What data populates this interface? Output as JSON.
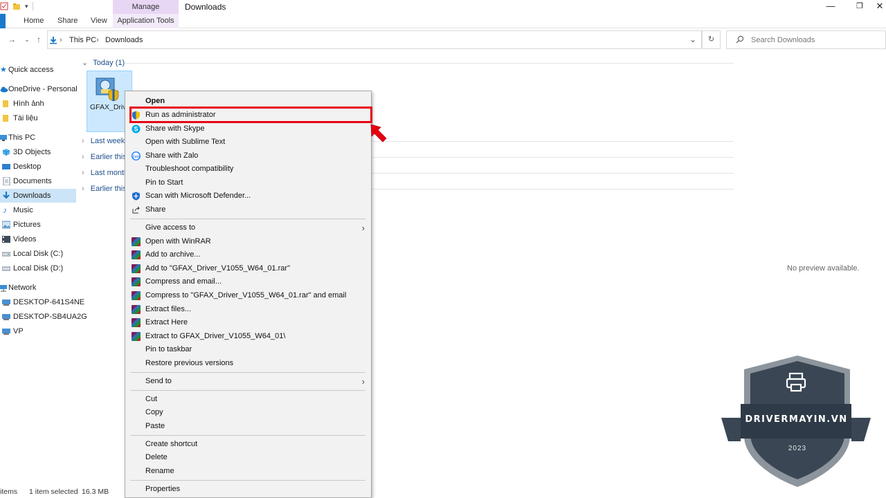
{
  "window": {
    "manage_tab": "Manage",
    "title": "Downloads",
    "minimize_glyph": "—",
    "maximize_glyph": "❐",
    "close_glyph": "✕"
  },
  "ribbon": {
    "tabs": [
      "Home",
      "Share",
      "View"
    ],
    "application_tools": "Application Tools"
  },
  "address": {
    "path": [
      "This PC",
      "Downloads"
    ],
    "search_placeholder": "Search Downloads"
  },
  "sidebar": {
    "items": [
      {
        "label": "Quick access",
        "icon": "star-icon"
      },
      {
        "label": "OneDrive - Personal",
        "icon": "cloud-icon"
      },
      {
        "label": "Hình ảnh",
        "icon": "folder-icon"
      },
      {
        "label": "Tài liệu",
        "icon": "folder-icon"
      },
      {
        "label": "This PC",
        "icon": "computer-icon"
      },
      {
        "label": "3D Objects",
        "icon": "cube-icon"
      },
      {
        "label": "Desktop",
        "icon": "desktop-icon"
      },
      {
        "label": "Documents",
        "icon": "documents-icon"
      },
      {
        "label": "Downloads",
        "icon": "download-icon"
      },
      {
        "label": "Music",
        "icon": "music-icon"
      },
      {
        "label": "Pictures",
        "icon": "pictures-icon"
      },
      {
        "label": "Videos",
        "icon": "videos-icon"
      },
      {
        "label": "Local Disk (C:)",
        "icon": "disk-icon"
      },
      {
        "label": "Local Disk (D:)",
        "icon": "disk-icon"
      },
      {
        "label": "Network",
        "icon": "network-icon"
      },
      {
        "label": "DESKTOP-641S4NE",
        "icon": "computer-icon"
      },
      {
        "label": "DESKTOP-SB4UA2G",
        "icon": "computer-icon"
      },
      {
        "label": "VP",
        "icon": "computer-icon"
      }
    ]
  },
  "main": {
    "groups": [
      "Today (1)",
      "Last week (",
      "Earlier this",
      "Last month",
      "Earlier this"
    ],
    "file_label": "GFAX_Driver_V1055_W64_01.exe",
    "preview": "No preview available."
  },
  "status": {
    "items": "items",
    "selected": "1 item selected",
    "size": "16.3 MB"
  },
  "context_menu": {
    "items": [
      {
        "label": "Open",
        "bold": true
      },
      {
        "label": "Run as administrator",
        "icon": "shield-icon"
      },
      {
        "label": "Share with Skype",
        "icon": "skype-icon"
      },
      {
        "label": "Open with Sublime Text"
      },
      {
        "label": "Share with Zalo",
        "icon": "zalo-icon"
      },
      {
        "label": "Troubleshoot compatibility"
      },
      {
        "label": "Pin to Start"
      },
      {
        "label": "Scan with Microsoft Defender...",
        "icon": "defender-icon"
      },
      {
        "label": "Share",
        "icon": "share-icon"
      },
      {
        "label": "Give access to",
        "submenu": true
      },
      {
        "label": "Open with WinRAR",
        "icon": "winrar-icon"
      },
      {
        "label": "Add to archive...",
        "icon": "winrar-icon"
      },
      {
        "label": "Add to \"GFAX_Driver_V1055_W64_01.rar\"",
        "icon": "winrar-icon"
      },
      {
        "label": "Compress and email...",
        "icon": "winrar-icon"
      },
      {
        "label": "Compress to \"GFAX_Driver_V1055_W64_01.rar\" and email",
        "icon": "winrar-icon"
      },
      {
        "label": "Extract files...",
        "icon": "winrar-icon"
      },
      {
        "label": "Extract Here",
        "icon": "winrar-icon"
      },
      {
        "label": "Extract to GFAX_Driver_V1055_W64_01\\",
        "icon": "winrar-icon"
      },
      {
        "label": "Pin to taskbar"
      },
      {
        "label": "Restore previous versions"
      },
      {
        "label": "Send to",
        "submenu": true
      },
      {
        "label": "Cut"
      },
      {
        "label": "Copy"
      },
      {
        "label": "Paste"
      },
      {
        "label": "Create shortcut"
      },
      {
        "label": "Delete"
      },
      {
        "label": "Rename"
      },
      {
        "label": "Properties"
      }
    ],
    "highlight_color": "#e60012"
  },
  "watermark": {
    "brand": "DRIVERMAYIN.VN",
    "year": "2023",
    "icon": "printer-icon"
  },
  "colors": {
    "accent": "#1979ca",
    "manage_tab": "#e8d6f5",
    "selection": "#cce8ff",
    "badge_dark": "#2e3a47"
  }
}
